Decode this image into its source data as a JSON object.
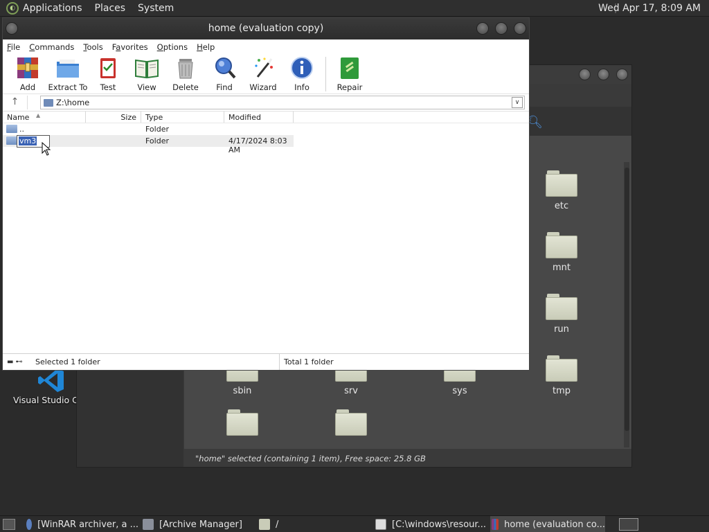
{
  "top_panel": {
    "menus": [
      "Applications",
      "Places",
      "System"
    ],
    "clock": "Wed Apr 17,  8:09 AM"
  },
  "desktop": {
    "icons": [
      {
        "label": "Visual Studio Code",
        "icon": "vscode-icon"
      }
    ]
  },
  "file_manager": {
    "folders": [
      "etc",
      "mnt",
      "run",
      "sbin",
      "srv",
      "sys",
      "tmp",
      "",
      ""
    ],
    "status": "\"home\" selected (containing 1 item), Free space: 25.8 GB"
  },
  "winrar": {
    "title": "home (evaluation copy)",
    "menu": [
      {
        "label": "File",
        "key": "F",
        "rest": "ile"
      },
      {
        "label": "Commands",
        "key": "C",
        "rest": "ommands"
      },
      {
        "label": "Tools",
        "key": "T",
        "rest": "ools"
      },
      {
        "label": "Favorites",
        "key": "a",
        "pre": "F",
        "rest": "vorites"
      },
      {
        "label": "Options",
        "key": "O",
        "rest": "ptions"
      },
      {
        "label": "Help",
        "key": "H",
        "rest": "elp"
      }
    ],
    "toolbar": [
      "Add",
      "Extract To",
      "Test",
      "View",
      "Delete",
      "Find",
      "Wizard",
      "Info",
      "Repair"
    ],
    "path": "Z:\\home",
    "columns": [
      "Name",
      "Size",
      "Type",
      "Modified"
    ],
    "rows": [
      {
        "name": "..",
        "size": "",
        "type": "Folder",
        "modified": ""
      },
      {
        "name": "vm3",
        "size": "",
        "type": "Folder",
        "modified": "4/17/2024 8:03 AM",
        "selected": true,
        "renaming": true
      }
    ],
    "status_left": "Selected 1 folder",
    "status_right": "Total 1 folder"
  },
  "taskbar": {
    "tasks": [
      {
        "label": "[WinRAR archiver, a ...",
        "icon": "browser-icon"
      },
      {
        "label": "[Archive Manager]",
        "icon": "archive-manager-icon"
      },
      {
        "label": "/",
        "icon": "folder-icon"
      },
      {
        "label": "[C:\\windows\\resour...",
        "icon": "wine-icon"
      },
      {
        "label": "home (evaluation co...",
        "icon": "winrar-icon",
        "active": true
      }
    ]
  },
  "colors": {
    "selection": "#3a62b4",
    "panel": "#2f2f2f",
    "folder": "#cdd0bd"
  }
}
